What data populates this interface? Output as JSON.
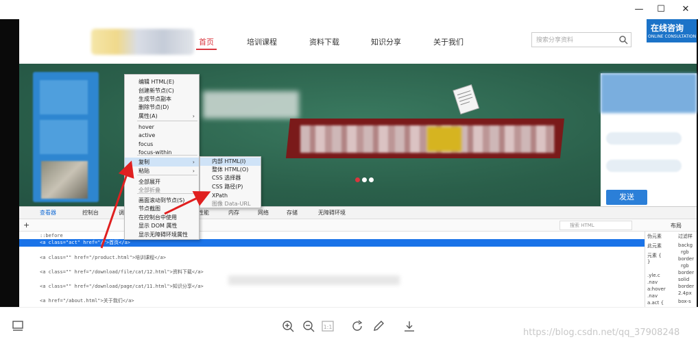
{
  "window": {
    "min": "—",
    "max": "☐",
    "close": "✕"
  },
  "site": {
    "nav": [
      "首页",
      "培训课程",
      "资料下载",
      "知识分享",
      "关于我们"
    ],
    "search_placeholder": "搜索分享资料",
    "consult_main": "在线咨询",
    "consult_sub": "ONLINE CONSULTATION"
  },
  "banner": {
    "send_label": "发送"
  },
  "context_menu": {
    "items": [
      {
        "label": "编辑 HTML(E)"
      },
      {
        "label": "创建新节点(C)"
      },
      {
        "label": "生成节点副本"
      },
      {
        "label": "删除节点(D)"
      },
      {
        "label": "属性(A)",
        "arrow": "›"
      },
      {
        "label": "hover"
      },
      {
        "label": "active"
      },
      {
        "label": "focus"
      },
      {
        "label": "focus-within"
      },
      {
        "label": "复制",
        "arrow": "›"
      },
      {
        "label": "粘贴",
        "arrow": "›"
      },
      {
        "label": "全部展开"
      },
      {
        "label": "全部折叠"
      },
      {
        "label": "画面滚动到节点(S)"
      },
      {
        "label": "节点截图"
      },
      {
        "label": "在控制台中使用"
      },
      {
        "label": "显示 DOM 属性"
      },
      {
        "label": "显示无障碍环境属性"
      }
    ],
    "submenu": [
      "内部 HTML(I)",
      "整体 HTML(O)",
      "CSS 选择器",
      "CSS 路径(P)",
      "XPath",
      "图像 Data-URL"
    ]
  },
  "devtools": {
    "tabs": [
      "查看器",
      "控制台",
      "调",
      "性能",
      "内存",
      "网络",
      "存储",
      "无障碍环境"
    ],
    "search_placeholder": "搜索 HTML",
    "lines": [
      "::before",
      "<a class=\"act\" href=\"/\">首页</a>",
      "<a class=\"\" href=\"/product.html\">培训课程</a>",
      "<a class=\"\" href=\"/download/file/cat/12.html\">资料下载</a>",
      "<a class=\"\" href=\"/download/page/cat/11.html\">知识分享</a>",
      "<a href=\"/about.html\">关于我们</a>"
    ],
    "right_panel": [
      "伪元素",
      "此元素",
      "元素 {",
      "}",
      ".yle.c",
      ".nav",
      "a:hover",
      ".nav",
      "a.act {"
    ],
    "right_props": [
      "backg",
      "rgb",
      "border",
      "rgb",
      "border",
      "solid",
      "border",
      "2.4px",
      "box-s"
    ],
    "right_header": "布局",
    "right_filter": "过滤样"
  },
  "viewer": {
    "watermark": "https://blog.csdn.net/qq_37908248"
  }
}
